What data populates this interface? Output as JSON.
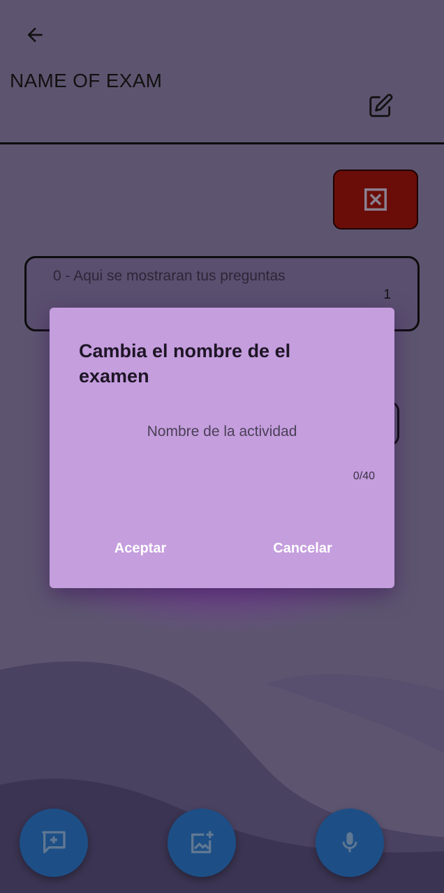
{
  "header": {
    "title": "NAME OF EXAM",
    "back_icon": "arrow-left-icon",
    "edit_icon": "edit-icon"
  },
  "toolbar": {
    "delete_icon": "close-box-icon",
    "delete_color": "#6a0d08"
  },
  "questions": [
    {
      "text": "0 - Aqui se mostraran tus preguntas",
      "count": "1"
    }
  ],
  "dialog": {
    "title": "Cambia el nombre de el examen",
    "input_placeholder": "Nombre de la actividad",
    "input_value": "",
    "counter": "0/40",
    "accept_label": "Aceptar",
    "cancel_label": "Cancelar",
    "background": "#c59ede"
  },
  "fabs": [
    {
      "icon": "add-comment-icon"
    },
    {
      "icon": "add-image-icon"
    },
    {
      "icon": "microphone-icon"
    }
  ],
  "colors": {
    "background": "#5d5570",
    "fab": "#1d4f86",
    "text_primary": "#111111"
  }
}
